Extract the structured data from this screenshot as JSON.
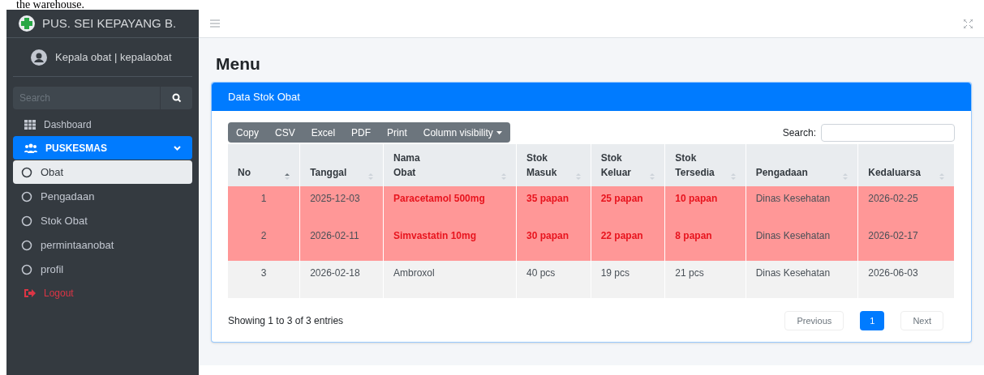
{
  "caption": "the warehouse.",
  "sidebar": {
    "brand": "PUS. SEI KEPAYANG B.",
    "user": "Kepala obat | kepalaobat",
    "search": {
      "placeholder": "Search"
    },
    "items": [
      {
        "label": "Dashboard",
        "kind": "grid",
        "selected": false
      },
      {
        "label": "PUSKESMAS",
        "kind": "group",
        "selected": true,
        "expanded": true,
        "children": [
          {
            "label": "Obat",
            "selected": true
          },
          {
            "label": "Pengadaan",
            "selected": false
          },
          {
            "label": "Stok Obat",
            "selected": false
          },
          {
            "label": "permintaanobat",
            "selected": false
          },
          {
            "label": "profil",
            "selected": false
          }
        ]
      },
      {
        "label": "Logout",
        "kind": "logout",
        "selected": false
      }
    ]
  },
  "page_title": "Menu",
  "card": {
    "title": "Data Stok Obat",
    "export_buttons": [
      "Copy",
      "CSV",
      "Excel",
      "PDF",
      "Print",
      "Column visibility"
    ],
    "search_label": "Search:",
    "table": {
      "columns": [
        {
          "label": "No",
          "sorted": true
        },
        {
          "label": "Tanggal",
          "sorted": false
        },
        {
          "label": "Nama Obat",
          "sorted": false
        },
        {
          "label": "Stok Masuk",
          "sorted": false
        },
        {
          "label": "Stok Keluar",
          "sorted": false
        },
        {
          "label": "Stok Tersedia",
          "sorted": false
        },
        {
          "label": "Pengadaan",
          "sorted": false
        },
        {
          "label": "Kedaluarsa",
          "sorted": false
        }
      ],
      "rows": [
        {
          "highlighted": true,
          "cells": [
            "1",
            "2025-12-03",
            "Paracetamol 500mg",
            "35 papan",
            "25 papan",
            "10 papan",
            "Dinas Kesehatan",
            "2026-02-25"
          ]
        },
        {
          "highlighted": true,
          "cells": [
            "2",
            "2026-02-11",
            "Simvastatin 10mg",
            "30 papan",
            "22 papan",
            "8 papan",
            "Dinas Kesehatan",
            "2026-02-17"
          ]
        },
        {
          "highlighted": false,
          "cells": [
            "3",
            "2026-02-18",
            "Ambroxol",
            "40 pcs",
            "19 pcs",
            "21 pcs",
            "Dinas Kesehatan",
            "2026-06-03"
          ]
        }
      ]
    },
    "info": "Showing 1 to 3 of 3 entries",
    "pagination": [
      {
        "label": "Previous",
        "selected": false
      },
      {
        "label": "1",
        "selected": true
      },
      {
        "label": "Next",
        "selected": false
      }
    ]
  }
}
